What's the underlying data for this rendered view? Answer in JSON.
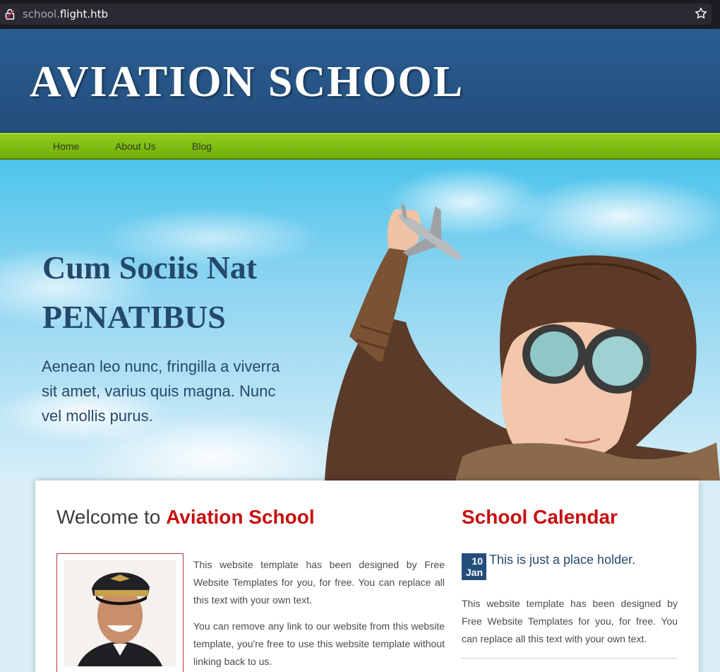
{
  "browser": {
    "url_subdomain": "school.",
    "url_domain": "flight.htb"
  },
  "header": {
    "logo": "AVIATION SCHOOL"
  },
  "nav": {
    "items": [
      {
        "label": "Home"
      },
      {
        "label": "About Us"
      },
      {
        "label": "Blog"
      }
    ]
  },
  "hero": {
    "title_line1": "Cum Sociis Nat",
    "title_line2": "PENATIBUS",
    "text": "Aenean leo nunc, fringilla a viverra sit amet, varius quis magna. Nunc vel mollis purus."
  },
  "welcome": {
    "heading_prefix": "Welcome to ",
    "heading_accent": "Aviation School",
    "para1": "This website template has been designed by Free Website Templates for you, for free. You can replace all this text with your own text.",
    "para2": "You can remove any link to our website from this website template, you're free to use this website template without linking back to us."
  },
  "calendar": {
    "heading": "School Calendar",
    "event": {
      "day": "10",
      "month": "Jan",
      "title": "This is just a place holder.",
      "text": "This website template has been designed by Free Website Templates for you, for free. You can replace all this text with your own text."
    }
  },
  "colors": {
    "header_blue": "#2a5d92",
    "nav_green": "#8fcc1c",
    "accent_red": "#c70f0f",
    "hero_text_blue": "#24486c"
  }
}
